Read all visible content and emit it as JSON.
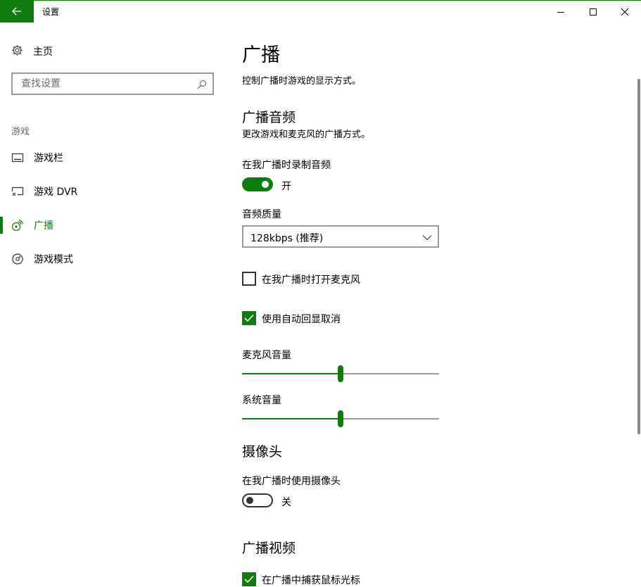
{
  "window": {
    "title": "设置",
    "accent": "#107c10"
  },
  "sidebar": {
    "home_label": "主页",
    "search_placeholder": "查找设置",
    "group_label": "游戏",
    "items": [
      {
        "label": "游戏栏",
        "icon": "game-bar-icon",
        "active": false
      },
      {
        "label": "游戏 DVR",
        "icon": "game-dvr-icon",
        "active": false
      },
      {
        "label": "广播",
        "icon": "broadcast-icon",
        "active": true
      },
      {
        "label": "游戏模式",
        "icon": "game-mode-icon",
        "active": false
      }
    ]
  },
  "main": {
    "title": "广播",
    "description": "控制广播时游戏的显示方式。",
    "audio_section": {
      "heading": "广播音频",
      "description": "更改游戏和麦克风的广播方式。",
      "record_audio_label": "在我广播时录制音频",
      "record_audio_state": "开",
      "record_audio_on": true,
      "quality_label": "音频质量",
      "quality_value": "128kbps (推荐)",
      "mic_checkbox_label": "在我广播时打开麦克风",
      "mic_checked": false,
      "echo_checkbox_label": "使用自动回显取消",
      "echo_checked": true,
      "mic_volume_label": "麦克风音量",
      "mic_volume": 0.5,
      "system_volume_label": "系统音量",
      "system_volume": 0.5
    },
    "camera_section": {
      "heading": "摄像头",
      "use_camera_label": "在我广播时使用摄像头",
      "use_camera_state": "关",
      "use_camera_on": false
    },
    "video_section": {
      "heading": "广播视频",
      "cursor_checkbox_label": "在广播中捕获鼠标光标",
      "cursor_checked": true
    }
  }
}
